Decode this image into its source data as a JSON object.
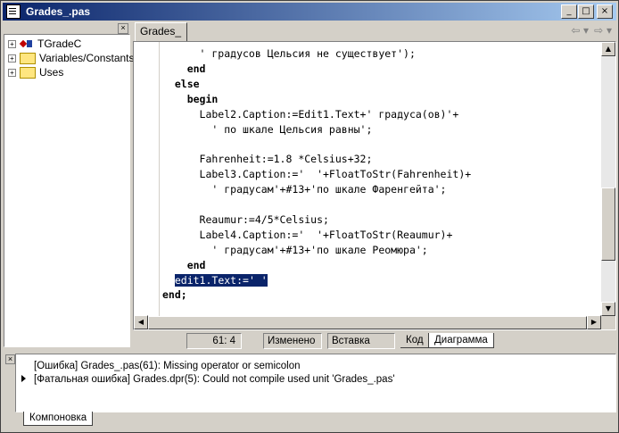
{
  "window": {
    "title": "Grades_.pas"
  },
  "tree": {
    "items": [
      {
        "label": "TGradeC",
        "icon": "class-icon"
      },
      {
        "label": "Variables/Constants",
        "icon": "folder-icon"
      },
      {
        "label": "Uses",
        "icon": "folder-icon"
      }
    ]
  },
  "editor": {
    "tab": "Grades_",
    "lines": [
      "      ' градусов Цельсия не существует');",
      "    end",
      "  else",
      "    begin",
      "      Label2.Caption:=Edit1.Text+' градуса(ов)'+",
      "        ' по шкале Цельсия равны';",
      "",
      "      Fahrenheit:=1.8 *Celsius+32;",
      "      Label3.Caption:='  '+FloatToStr(Fahrenheit)+",
      "        ' градусам'+#13+'по шкале Фаренгейта';",
      "",
      "      Reaumur:=4/5*Celsius;",
      "      Label4.Caption:='  '+FloatToStr(Reaumur)+",
      "        ' градусам'+#13+'по шкале Реомюра';",
      "    end",
      "  edit1.Text:=' '",
      "end;"
    ]
  },
  "status": {
    "position": "61:  4",
    "modified": "Изменено",
    "mode": "Вставка",
    "tab_code": "Код",
    "tab_diagram": "Диаграмма"
  },
  "messages": {
    "items": [
      "[Ошибка] Grades_.pas(61): Missing operator or semicolon",
      "[Фатальная ошибка] Grades.dpr(5): Could not compile used unit 'Grades_.pas'"
    ],
    "tab": "Компоновка"
  }
}
